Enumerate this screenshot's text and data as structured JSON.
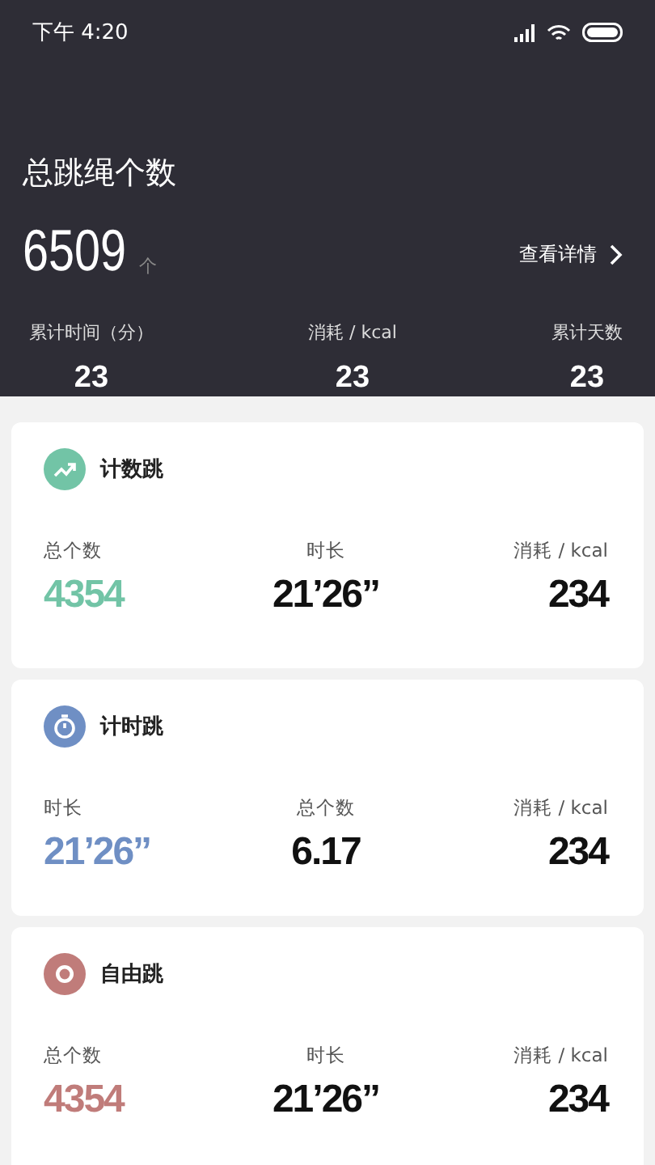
{
  "status_bar": {
    "time": "下午 4:20"
  },
  "summary": {
    "title": "总跳绳个数",
    "total": "6509",
    "unit": "个",
    "details_link": "查看详情",
    "stats": [
      {
        "label": "累计时间（分）",
        "value": "23"
      },
      {
        "label": "消耗 / kcal",
        "value": "23"
      },
      {
        "label": "累计天数",
        "value": "23"
      }
    ]
  },
  "cards": [
    {
      "kind": "trend",
      "title": "计数跳",
      "color": "#72c4a6",
      "stats": [
        {
          "label": "总个数",
          "value": "4354",
          "highlight": true
        },
        {
          "label": "时长",
          "value": "21’26”",
          "highlight": false
        },
        {
          "label": "消耗 / kcal",
          "value": "234",
          "highlight": false
        }
      ]
    },
    {
      "kind": "timer",
      "title": "计时跳",
      "color": "#6f8fc4",
      "stats": [
        {
          "label": "时长",
          "value": "21’26”",
          "highlight": true
        },
        {
          "label": "总个数",
          "value": "6.17",
          "highlight": false
        },
        {
          "label": "消耗 / kcal",
          "value": "234",
          "highlight": false
        }
      ]
    },
    {
      "kind": "target",
      "title": "自由跳",
      "color": "#c07c7a",
      "stats": [
        {
          "label": "总个数",
          "value": "4354",
          "highlight": true
        },
        {
          "label": "时长",
          "value": "21’26”",
          "highlight": false
        },
        {
          "label": "消耗 / kcal",
          "value": "234",
          "highlight": false
        }
      ]
    }
  ]
}
